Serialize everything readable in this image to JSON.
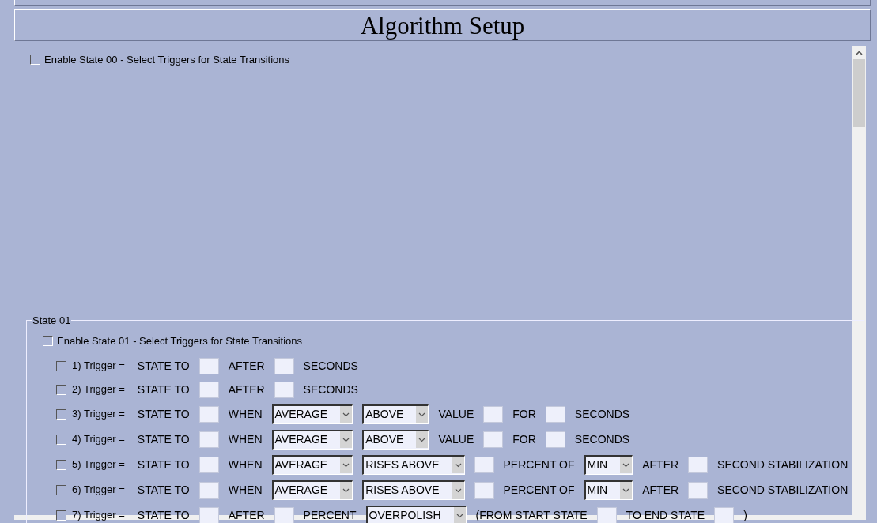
{
  "title": "Algorithm Setup",
  "state_00": {
    "label": "Enable State 00 - Select Triggers for State Transitions",
    "checked": false
  },
  "state_01": {
    "legend": "State 01",
    "enable": {
      "label": "Enable State 01 - Select Triggers for State Transitions",
      "checked": false
    },
    "triggers": [
      {
        "label": "1) Trigger =",
        "checked": false,
        "parts": [
          {
            "kind": "text",
            "text": "STATE TO"
          },
          {
            "kind": "field"
          },
          {
            "kind": "text",
            "text": "AFTER"
          },
          {
            "kind": "field"
          },
          {
            "kind": "text",
            "text": "SECONDS"
          }
        ]
      },
      {
        "label": "2) Trigger =",
        "checked": false,
        "parts": [
          {
            "kind": "text",
            "text": "STATE TO"
          },
          {
            "kind": "field"
          },
          {
            "kind": "text",
            "text": "AFTER"
          },
          {
            "kind": "field"
          },
          {
            "kind": "text",
            "text": "SECONDS"
          }
        ]
      },
      {
        "label": "3) Trigger =",
        "checked": false,
        "parts": [
          {
            "kind": "text",
            "text": "STATE TO"
          },
          {
            "kind": "field"
          },
          {
            "kind": "text",
            "text": "WHEN"
          },
          {
            "kind": "select",
            "value": "AVERAGE"
          },
          {
            "kind": "select",
            "value": "ABOVE"
          },
          {
            "kind": "text",
            "text": "VALUE"
          },
          {
            "kind": "field"
          },
          {
            "kind": "text",
            "text": "FOR"
          },
          {
            "kind": "field"
          },
          {
            "kind": "text",
            "text": "SECONDS"
          }
        ]
      },
      {
        "label": "4) Trigger =",
        "checked": false,
        "parts": [
          {
            "kind": "text",
            "text": "STATE TO"
          },
          {
            "kind": "field"
          },
          {
            "kind": "text",
            "text": "WHEN"
          },
          {
            "kind": "select",
            "value": "AVERAGE"
          },
          {
            "kind": "select",
            "value": "ABOVE"
          },
          {
            "kind": "text",
            "text": "VALUE"
          },
          {
            "kind": "field"
          },
          {
            "kind": "text",
            "text": "FOR"
          },
          {
            "kind": "field"
          },
          {
            "kind": "text",
            "text": "SECONDS"
          }
        ]
      },
      {
        "label": "5) Trigger =",
        "checked": false,
        "parts": [
          {
            "kind": "text",
            "text": "STATE TO"
          },
          {
            "kind": "field"
          },
          {
            "kind": "text",
            "text": "WHEN"
          },
          {
            "kind": "select",
            "value": "AVERAGE"
          },
          {
            "kind": "select",
            "value": "RISES ABOVE"
          },
          {
            "kind": "field"
          },
          {
            "kind": "text",
            "text": "PERCENT OF"
          },
          {
            "kind": "select",
            "value": "MIN"
          },
          {
            "kind": "text",
            "text": "AFTER"
          },
          {
            "kind": "field"
          },
          {
            "kind": "text",
            "text": "SECOND STABILIZATION"
          }
        ]
      },
      {
        "label": "6) Trigger =",
        "checked": false,
        "parts": [
          {
            "kind": "text",
            "text": "STATE TO"
          },
          {
            "kind": "field"
          },
          {
            "kind": "text",
            "text": "WHEN"
          },
          {
            "kind": "select",
            "value": "AVERAGE"
          },
          {
            "kind": "select",
            "value": "RISES ABOVE"
          },
          {
            "kind": "field"
          },
          {
            "kind": "text",
            "text": "PERCENT OF"
          },
          {
            "kind": "select",
            "value": "MIN"
          },
          {
            "kind": "text",
            "text": "AFTER"
          },
          {
            "kind": "field"
          },
          {
            "kind": "text",
            "text": "SECOND STABILIZATION"
          }
        ]
      },
      {
        "label": "7) Trigger =",
        "checked": false,
        "parts": [
          {
            "kind": "text",
            "text": "STATE TO"
          },
          {
            "kind": "field"
          },
          {
            "kind": "text",
            "text": "AFTER"
          },
          {
            "kind": "field"
          },
          {
            "kind": "text",
            "text": "PERCENT"
          },
          {
            "kind": "select",
            "value": "OVERPOLISH"
          },
          {
            "kind": "text",
            "text": "(FROM START STATE"
          },
          {
            "kind": "field"
          },
          {
            "kind": "text",
            "text": "TO END STATE"
          },
          {
            "kind": "field"
          },
          {
            "kind": "text",
            "text": ")"
          }
        ]
      }
    ]
  }
}
